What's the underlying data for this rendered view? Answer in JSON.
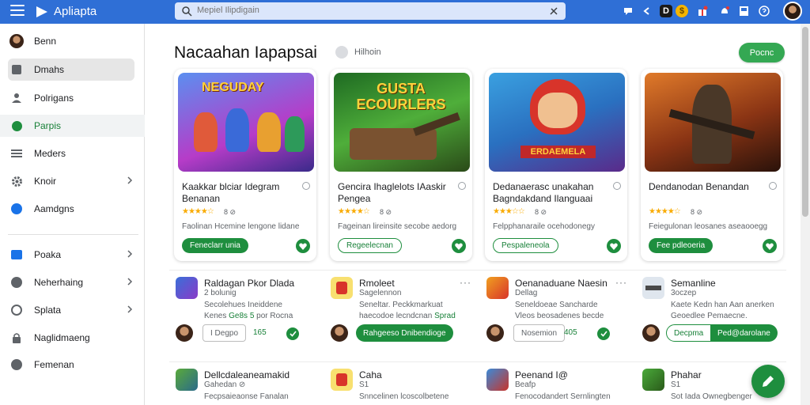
{
  "app": {
    "title": "Apliapta"
  },
  "search": {
    "placeholder": "Mepiel Ilipdigain"
  },
  "header": {
    "title": "Nacaahan Iapapsai",
    "tag": "Hilhoin",
    "action_label": "Pocnc"
  },
  "sidebar": {
    "items": [
      {
        "label": "Benn",
        "icon": "avatar-icon"
      },
      {
        "label": "Dmahs",
        "icon": "home-icon"
      },
      {
        "label": "Polrigans",
        "icon": "person-icon"
      },
      {
        "label": "Parpis",
        "icon": "leaf-icon"
      },
      {
        "label": "Meders",
        "icon": "list-icon"
      },
      {
        "label": "Knoir",
        "icon": "gear-icon"
      },
      {
        "label": "Aamdgns",
        "icon": "chat-icon"
      },
      {
        "label": "Poaka",
        "icon": "folder-icon"
      },
      {
        "label": "Neherhaing",
        "icon": "globe-icon"
      },
      {
        "label": "Splata",
        "icon": "target-icon"
      },
      {
        "label": "Naglidmaeng",
        "icon": "lock-icon"
      },
      {
        "label": "Femenan",
        "icon": "circle-icon"
      }
    ]
  },
  "cards": [
    {
      "title": "Kaakkar blciar Idegram Benanan",
      "rating": "8 ⊘",
      "desc": "Faolinan Hcemine lengone lidane",
      "button": "Feneclarr unia",
      "banner": "NEGUDAY",
      "colors": [
        "#3a6fd8",
        "#c33ab0"
      ]
    },
    {
      "title": "Gencira Ihaglelots IAaskir Pengea",
      "rating": "8 ⊘",
      "desc": "Fageinan lireinsite secobe aedorg",
      "button": "Regeelecnan",
      "banner": "GUSTA ECOURLERS",
      "colors": [
        "#2d7d2a",
        "#e8a024"
      ]
    },
    {
      "title": "Dedanaerasc unakahan Bagndakdand Ilanguaai",
      "rating": "8 ⊘",
      "desc": "Felpphanaraile ocehodonegy",
      "button": "Pespaleneola",
      "banner": "ERDAEMELA",
      "colors": [
        "#2b8fd0",
        "#d8342a"
      ]
    },
    {
      "title": "Dendanodan Benandan",
      "rating": "8 ⊘",
      "desc": "Feiegulonan leosanes aseaooegg",
      "button": "Fee pdleoeria",
      "banner": "",
      "colors": [
        "#7a2e12",
        "#e07a2a"
      ]
    }
  ],
  "list_row1": [
    {
      "title": "Raldagan Pkor Dlada",
      "sub": "2 bolunig",
      "d1": "Secolehues Ineiddene",
      "d2a": "Kenes",
      "d2g": "Ge8s 5",
      "d2b": "por Rocna",
      "btn": "I Degpo",
      "count": "165",
      "style": "ghost"
    },
    {
      "title": "Rmoleet",
      "sub": "Sagelennon",
      "d1": "Seneltar. Peckkmarkuat",
      "d2a": "haecodoe lecndcnan",
      "d2g": "Sprad",
      "d2b": "",
      "btn": "Rahgeeso Dnibendioge",
      "count": "",
      "style": "solid"
    },
    {
      "title": "Oenanaduane Naesin",
      "sub": "Dellag",
      "d1": "Seneldoeae Sancharde",
      "d2a": "Vleos beosadenes becde",
      "d2g": "",
      "d2b": "",
      "btn": "Nosemion",
      "count": "405",
      "style": "ghost"
    },
    {
      "title": "Semanline",
      "sub": "3oczep",
      "d1": "Kaete Kedn han Aan anerken",
      "d2a": "Geoedlee Pemaecne.",
      "d2g": "",
      "d2b": "",
      "btn": "Decpma",
      "btn2": "Ped@darolane",
      "count": "",
      "style": "split"
    }
  ],
  "list_row2": [
    {
      "title": "Dellcdaleaneamakid",
      "sub": "Gahedan ⊘",
      "d1": "Fecpsaieaonse Fanalan"
    },
    {
      "title": "Caha",
      "sub": "S1",
      "d1": "Snncelinen lcoscolbetene"
    },
    {
      "title": "Peenand I@",
      "sub": "Beafp",
      "d1": "Fenocodandert Sernlingten"
    },
    {
      "title": "Phahar",
      "sub": "S1",
      "d1": "Sot Iada Ownegbenger"
    }
  ],
  "colors": {
    "topbar": "#2f6fd6",
    "accent": "#1e8e3e"
  }
}
